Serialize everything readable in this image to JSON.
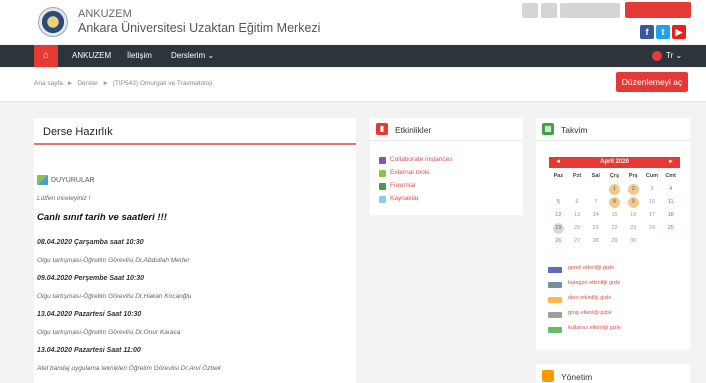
{
  "header": {
    "site_name": "ANKUZEM",
    "site_subtitle": "Ankara Üniversitesi Uzaktan Eğitim Merkezi",
    "top_btn_3": "",
    "login_label": "",
    "social": {
      "fb": "f",
      "tw": "t",
      "yt": "▶"
    }
  },
  "nav": {
    "home_icon": "⌂",
    "items": [
      "ANKUZEM",
      "İletişim",
      "Derslerim ⌄"
    ],
    "lang": "Tr ⌄"
  },
  "breadcrumb": {
    "items": [
      "Ana sayfa",
      "Dersler",
      "(TIP543) Omurgalı ve Travmatoloji"
    ],
    "sep": "►"
  },
  "edit_button": "Düzenlemeyi aç",
  "main": {
    "title": "Derse Hazırlık",
    "announcement_label": "DUYURULAR",
    "notice": "Lütfen inceleyiniz !",
    "headline": "Canlı sınıf tarih ve saatleri !!!",
    "entries": [
      {
        "date": "08.04.2020 Çarşamba saat 10:30",
        "desc": "Olgu tartışması-Öğretim Görevlisi Dr.Abdullah Merter"
      },
      {
        "date": "09.04.2020 Perşembe Saat 10:30",
        "desc": "Olgu tartışması-Öğretim Görevlisi Dr.Hakan Kocaoğlu"
      },
      {
        "date": "13.04.2020 Pazartesi Saat 10:30",
        "desc": "Olgu tartışması-Öğretim Görevlisi Dr.Onur Karaca"
      },
      {
        "date": "13.04.2020 Pazartesi Saat 11:00",
        "desc": "Atel bandaj uygulama teknikleri Öğretim Görevlisi Dr.Anıl Özbek"
      }
    ]
  },
  "activities": {
    "title": "Etkinlikler",
    "items": [
      {
        "label": "Collaborate instances",
        "color": "#7e57c2"
      },
      {
        "label": "External tools",
        "color": "#8bc34a"
      },
      {
        "label": "Forumlar",
        "color": "#43a047"
      },
      {
        "label": "Kaynaklar",
        "color": "#90caf9"
      }
    ],
    "accent": "#e53935"
  },
  "calendar": {
    "title": "Takvim",
    "accent": "#43a047",
    "month": "April 2020",
    "prev": "◄",
    "next": "►",
    "weekdays": [
      "Paz",
      "Pzt",
      "Sal",
      "Çrş",
      "Prş",
      "Cum",
      "Cmt"
    ],
    "weeks": [
      [
        "",
        "",
        "",
        "1",
        "2",
        "3",
        "4"
      ],
      [
        "5",
        "6",
        "7",
        "8",
        "9",
        "10",
        "11"
      ],
      [
        "12",
        "13",
        "14",
        "15",
        "16",
        "17",
        "18"
      ],
      [
        "19",
        "20",
        "21",
        "22",
        "23",
        "24",
        "25"
      ],
      [
        "26",
        "27",
        "28",
        "29",
        "30",
        "",
        ""
      ]
    ],
    "event_days": [
      "1",
      "2",
      "8",
      "9"
    ],
    "today": "19",
    "legend": [
      {
        "label": "genel etkinliği gizle",
        "color": "#5c6bc0"
      },
      {
        "label": "kategori etkinliği gizle",
        "color": "#78909c"
      },
      {
        "label": "ders etkinliği gizle",
        "color": "#ffb74d"
      },
      {
        "label": "grup etkinliği gizle",
        "color": "#9e9e9e"
      },
      {
        "label": "kullanıcı etkinliği gizle",
        "color": "#66bb6a"
      }
    ]
  },
  "management": {
    "title": "Yönetim"
  },
  "colors": {
    "primary": "#e53935",
    "navbar": "#2d353c"
  }
}
